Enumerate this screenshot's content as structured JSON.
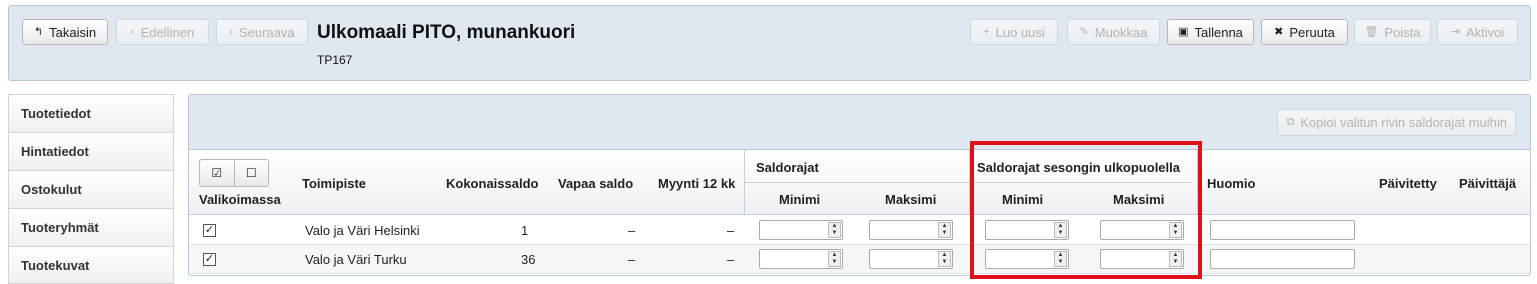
{
  "header": {
    "buttons_left": [
      {
        "label": "Takaisin",
        "icon": "↰",
        "enabled": true
      },
      {
        "label": "Edellinen",
        "icon": "‹",
        "enabled": false
      },
      {
        "label": "Seuraava",
        "icon": "›",
        "enabled": false
      }
    ],
    "title": "Ulkomaali PITO, munankuori",
    "subtitle": "TP167",
    "buttons_right": [
      {
        "label": "Luo uusi",
        "icon": "+",
        "enabled": false
      },
      {
        "label": "Muokkaa",
        "icon": "✎",
        "enabled": false
      },
      {
        "label": "Tallenna",
        "icon": "▣",
        "enabled": true
      },
      {
        "label": "Peruuta",
        "icon": "✖",
        "enabled": true
      },
      {
        "label": "Poista",
        "icon": "🗑",
        "enabled": false
      },
      {
        "label": "Aktivoi",
        "icon": "⇥",
        "enabled": false
      }
    ]
  },
  "sidebar": {
    "items": [
      {
        "label": "Tuotetiedot"
      },
      {
        "label": "Hintatiedot"
      },
      {
        "label": "Ostokulut"
      },
      {
        "label": "Tuoteryhmät"
      },
      {
        "label": "Tuotekuvat"
      }
    ]
  },
  "panel": {
    "copy_button": {
      "label": "Kopioi valitun rivin saldorajat muihin",
      "icon": "⧉"
    },
    "select_all_icon": "☑",
    "select_none_icon": "☐",
    "columns": {
      "valikoimassa": "Valikoimassa",
      "toimipiste": "Toimipiste",
      "kokonaissaldo": "Kokonaissaldo",
      "vapaa_saldo": "Vapaa saldo",
      "myynti": "Myynti 12 kk",
      "saldorajat": "Saldorajat",
      "saldorajat_min": "Minimi",
      "saldorajat_max": "Maksimi",
      "sesonki": "Saldorajat sesongin ulkopuolella",
      "sesonki_min": "Minimi",
      "sesonki_max": "Maksimi",
      "huomio": "Huomio",
      "paivitetty": "Päivitetty",
      "paivittaja": "Päivittäjä"
    },
    "rows": [
      {
        "checked": "✓",
        "toimipiste": "Valo ja Väri Helsinki",
        "kokonaissaldo": "1",
        "vapaa_saldo": "–",
        "myynti": "–"
      },
      {
        "checked": "✓",
        "toimipiste": "Valo ja Väri Turku",
        "kokonaissaldo": "36",
        "vapaa_saldo": "–",
        "myynti": "–"
      }
    ],
    "spin_arrows": "▲▼"
  },
  "colors": {
    "highlight": "#e0101a",
    "header_bg": "#dfe8f0"
  }
}
